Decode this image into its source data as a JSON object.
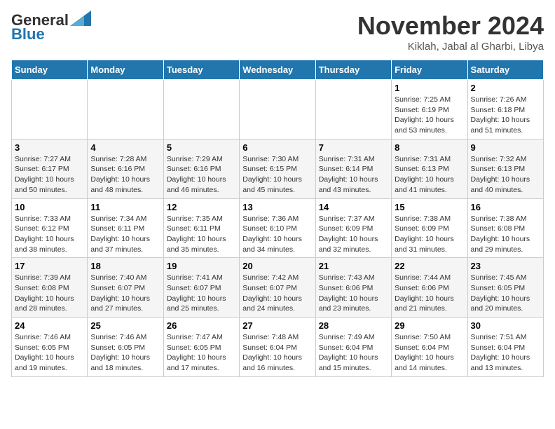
{
  "header": {
    "logo_general": "General",
    "logo_blue": "Blue",
    "month_title": "November 2024",
    "location": "Kiklah, Jabal al Gharbi, Libya"
  },
  "weekdays": [
    "Sunday",
    "Monday",
    "Tuesday",
    "Wednesday",
    "Thursday",
    "Friday",
    "Saturday"
  ],
  "weeks": [
    [
      {
        "day": "",
        "info": ""
      },
      {
        "day": "",
        "info": ""
      },
      {
        "day": "",
        "info": ""
      },
      {
        "day": "",
        "info": ""
      },
      {
        "day": "",
        "info": ""
      },
      {
        "day": "1",
        "info": "Sunrise: 7:25 AM\nSunset: 6:19 PM\nDaylight: 10 hours and 53 minutes."
      },
      {
        "day": "2",
        "info": "Sunrise: 7:26 AM\nSunset: 6:18 PM\nDaylight: 10 hours and 51 minutes."
      }
    ],
    [
      {
        "day": "3",
        "info": "Sunrise: 7:27 AM\nSunset: 6:17 PM\nDaylight: 10 hours and 50 minutes."
      },
      {
        "day": "4",
        "info": "Sunrise: 7:28 AM\nSunset: 6:16 PM\nDaylight: 10 hours and 48 minutes."
      },
      {
        "day": "5",
        "info": "Sunrise: 7:29 AM\nSunset: 6:16 PM\nDaylight: 10 hours and 46 minutes."
      },
      {
        "day": "6",
        "info": "Sunrise: 7:30 AM\nSunset: 6:15 PM\nDaylight: 10 hours and 45 minutes."
      },
      {
        "day": "7",
        "info": "Sunrise: 7:31 AM\nSunset: 6:14 PM\nDaylight: 10 hours and 43 minutes."
      },
      {
        "day": "8",
        "info": "Sunrise: 7:31 AM\nSunset: 6:13 PM\nDaylight: 10 hours and 41 minutes."
      },
      {
        "day": "9",
        "info": "Sunrise: 7:32 AM\nSunset: 6:13 PM\nDaylight: 10 hours and 40 minutes."
      }
    ],
    [
      {
        "day": "10",
        "info": "Sunrise: 7:33 AM\nSunset: 6:12 PM\nDaylight: 10 hours and 38 minutes."
      },
      {
        "day": "11",
        "info": "Sunrise: 7:34 AM\nSunset: 6:11 PM\nDaylight: 10 hours and 37 minutes."
      },
      {
        "day": "12",
        "info": "Sunrise: 7:35 AM\nSunset: 6:11 PM\nDaylight: 10 hours and 35 minutes."
      },
      {
        "day": "13",
        "info": "Sunrise: 7:36 AM\nSunset: 6:10 PM\nDaylight: 10 hours and 34 minutes."
      },
      {
        "day": "14",
        "info": "Sunrise: 7:37 AM\nSunset: 6:09 PM\nDaylight: 10 hours and 32 minutes."
      },
      {
        "day": "15",
        "info": "Sunrise: 7:38 AM\nSunset: 6:09 PM\nDaylight: 10 hours and 31 minutes."
      },
      {
        "day": "16",
        "info": "Sunrise: 7:38 AM\nSunset: 6:08 PM\nDaylight: 10 hours and 29 minutes."
      }
    ],
    [
      {
        "day": "17",
        "info": "Sunrise: 7:39 AM\nSunset: 6:08 PM\nDaylight: 10 hours and 28 minutes."
      },
      {
        "day": "18",
        "info": "Sunrise: 7:40 AM\nSunset: 6:07 PM\nDaylight: 10 hours and 27 minutes."
      },
      {
        "day": "19",
        "info": "Sunrise: 7:41 AM\nSunset: 6:07 PM\nDaylight: 10 hours and 25 minutes."
      },
      {
        "day": "20",
        "info": "Sunrise: 7:42 AM\nSunset: 6:07 PM\nDaylight: 10 hours and 24 minutes."
      },
      {
        "day": "21",
        "info": "Sunrise: 7:43 AM\nSunset: 6:06 PM\nDaylight: 10 hours and 23 minutes."
      },
      {
        "day": "22",
        "info": "Sunrise: 7:44 AM\nSunset: 6:06 PM\nDaylight: 10 hours and 21 minutes."
      },
      {
        "day": "23",
        "info": "Sunrise: 7:45 AM\nSunset: 6:05 PM\nDaylight: 10 hours and 20 minutes."
      }
    ],
    [
      {
        "day": "24",
        "info": "Sunrise: 7:46 AM\nSunset: 6:05 PM\nDaylight: 10 hours and 19 minutes."
      },
      {
        "day": "25",
        "info": "Sunrise: 7:46 AM\nSunset: 6:05 PM\nDaylight: 10 hours and 18 minutes."
      },
      {
        "day": "26",
        "info": "Sunrise: 7:47 AM\nSunset: 6:05 PM\nDaylight: 10 hours and 17 minutes."
      },
      {
        "day": "27",
        "info": "Sunrise: 7:48 AM\nSunset: 6:04 PM\nDaylight: 10 hours and 16 minutes."
      },
      {
        "day": "28",
        "info": "Sunrise: 7:49 AM\nSunset: 6:04 PM\nDaylight: 10 hours and 15 minutes."
      },
      {
        "day": "29",
        "info": "Sunrise: 7:50 AM\nSunset: 6:04 PM\nDaylight: 10 hours and 14 minutes."
      },
      {
        "day": "30",
        "info": "Sunrise: 7:51 AM\nSunset: 6:04 PM\nDaylight: 10 hours and 13 minutes."
      }
    ]
  ]
}
